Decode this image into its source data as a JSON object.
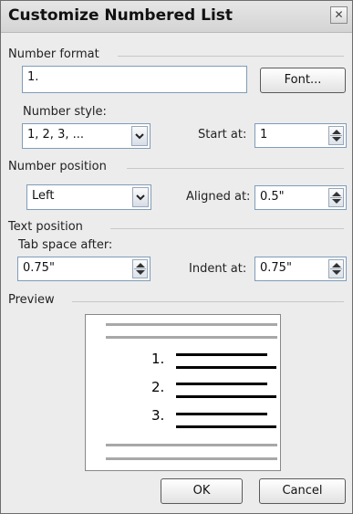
{
  "dialog": {
    "title": "Customize Numbered List",
    "close_glyph": "✕"
  },
  "number_format": {
    "group_label": "Number format",
    "value": "1.",
    "font_button": "Font...",
    "style_label": "Number style:",
    "style_value": "1, 2, 3, ...",
    "start_label": "Start at:",
    "start_value": "1"
  },
  "number_position": {
    "group_label": "Number position",
    "value": "Left",
    "aligned_label": "Aligned at:",
    "aligned_value": "0.5\""
  },
  "text_position": {
    "group_label": "Text position",
    "tab_label": "Tab space after:",
    "tab_value": "0.75\"",
    "indent_label": "Indent at:",
    "indent_value": "0.75\""
  },
  "preview": {
    "group_label": "Preview",
    "numbers": [
      "1.",
      "2.",
      "3."
    ]
  },
  "buttons": {
    "ok": "OK",
    "cancel": "Cancel"
  },
  "icons": {
    "close": "close-icon",
    "dropdown": "chevron-down-icon",
    "spinner": "spinner-arrows-icon"
  }
}
